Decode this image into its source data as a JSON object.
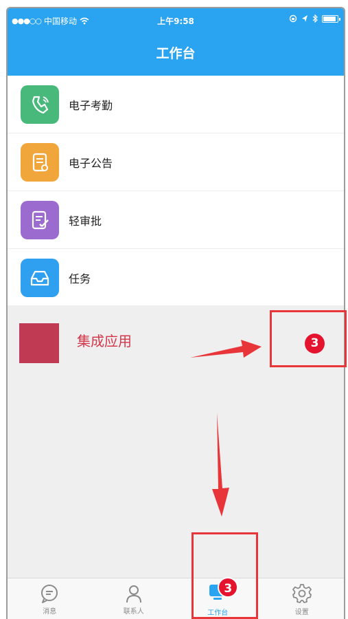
{
  "status_bar": {
    "carrier": "中国移动",
    "time": "上午9:58"
  },
  "nav": {
    "title": "工作台"
  },
  "menu": [
    {
      "label": "电子考勤",
      "color": "#48b97b",
      "icon": "phone-icon"
    },
    {
      "label": "电子公告",
      "color": "#f0a63a",
      "icon": "notice-icon"
    },
    {
      "label": "轻审批",
      "color": "#9b6bd0",
      "icon": "approval-icon"
    },
    {
      "label": "任务",
      "color": "#2f9ff0",
      "icon": "inbox-icon"
    }
  ],
  "integrated": {
    "label": "集成应用",
    "tile_color": "#bf3a52",
    "badge": "3"
  },
  "tabs": [
    {
      "label": "消息",
      "icon": "message-icon"
    },
    {
      "label": "联系人",
      "icon": "contacts-icon"
    },
    {
      "label": "工作台",
      "icon": "workbench-icon",
      "badge": "3",
      "active": true
    },
    {
      "label": "设置",
      "icon": "settings-icon"
    }
  ],
  "colors": {
    "accent": "#2aa3f0",
    "badge": "#e4132e",
    "annotation": "#e8353a"
  }
}
